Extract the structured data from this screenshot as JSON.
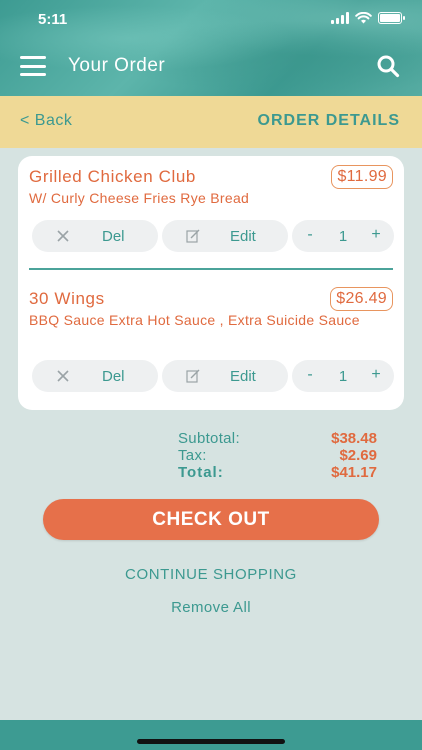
{
  "status": {
    "time": "5:11"
  },
  "header": {
    "title": "Your Order"
  },
  "subbar": {
    "back_label": "< Back",
    "section_title": "ORDER DETAILS"
  },
  "items": [
    {
      "name": "Grilled Chicken Club",
      "description": "W/ Curly Cheese Fries Rye Bread",
      "price": "$11.99",
      "del_label": "Del",
      "edit_label": "Edit",
      "quantity": "1",
      "minus": "-",
      "plus": "+"
    },
    {
      "name": "30 Wings",
      "description": "BBQ Sauce Extra Hot Sauce , Extra Suicide Sauce",
      "price": "$26.49",
      "del_label": "Del",
      "edit_label": "Edit",
      "quantity": "1",
      "minus": "-",
      "plus": "+"
    }
  ],
  "totals": {
    "subtotal_label": "Subtotal:",
    "subtotal_value": "$38.48",
    "tax_label": "Tax:",
    "tax_value": "$2.69",
    "total_label": "Total:",
    "total_value": "$41.17"
  },
  "actions": {
    "checkout_label": "CHECK OUT",
    "continue_label": "CONTINUE SHOPPING",
    "remove_all_label": "Remove All"
  },
  "colors": {
    "teal": "#3c9990",
    "orange": "#e06a3f",
    "yellow": "#efd996",
    "background": "#d6e3e1"
  },
  "icons": [
    "menu-icon",
    "search-icon",
    "close-icon",
    "edit-icon",
    "wifi-icon",
    "battery-icon",
    "signal-icon"
  ]
}
